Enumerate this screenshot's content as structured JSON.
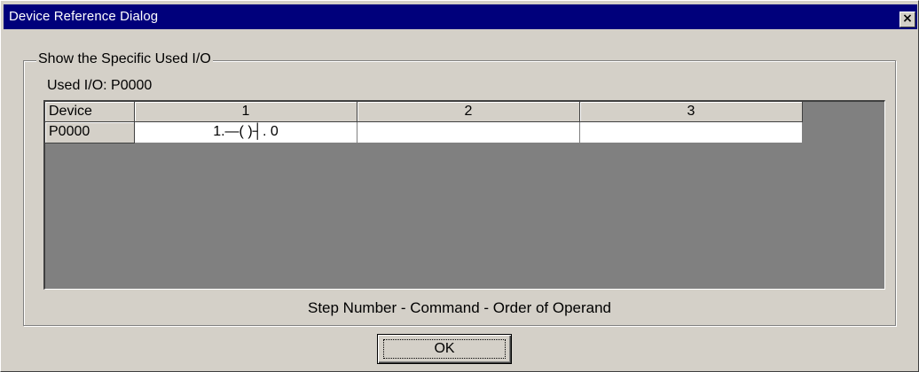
{
  "window": {
    "title": "Device Reference Dialog",
    "close_glyph": "×",
    "title_bar_color": "#00007b",
    "face_color": "#d4d0c8"
  },
  "group": {
    "label": "Show the Specific Used I/O",
    "used_io": "Used I/O: P0000"
  },
  "table": {
    "columns": [
      "Device",
      "1",
      "2",
      "3"
    ],
    "rows": [
      {
        "device": "P0000",
        "cells": [
          "1.—( )┤. 0",
          "",
          ""
        ]
      }
    ]
  },
  "legend_caption": "Step Number - Command - Order of Operand",
  "buttons": {
    "ok_label": "OK"
  },
  "icons": {
    "close": "close-icon"
  }
}
